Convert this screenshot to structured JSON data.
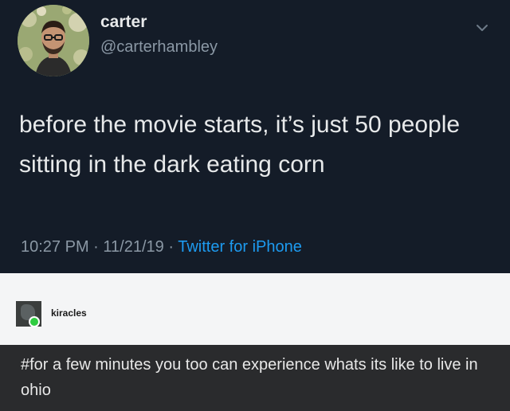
{
  "tweet": {
    "display_name": "carter",
    "handle": "@carterhambley",
    "text": "before the movie starts, it’s just 50 people sitting in the dark eating corn",
    "time": "10:27 PM",
    "separator1": "·",
    "date": "11/21/19",
    "separator2": "·",
    "source": "Twitter for iPhone",
    "menu_icon": "chevron-down-icon"
  },
  "reply": {
    "username": "kiracles",
    "text": "#for a few minutes you too can experience whats its like to live in ohio"
  },
  "colors": {
    "tweet_bg": "#141c28",
    "source_link": "#1d9bf0",
    "reply_bg": "#2a2b2d",
    "online_status": "#2ecc40"
  }
}
